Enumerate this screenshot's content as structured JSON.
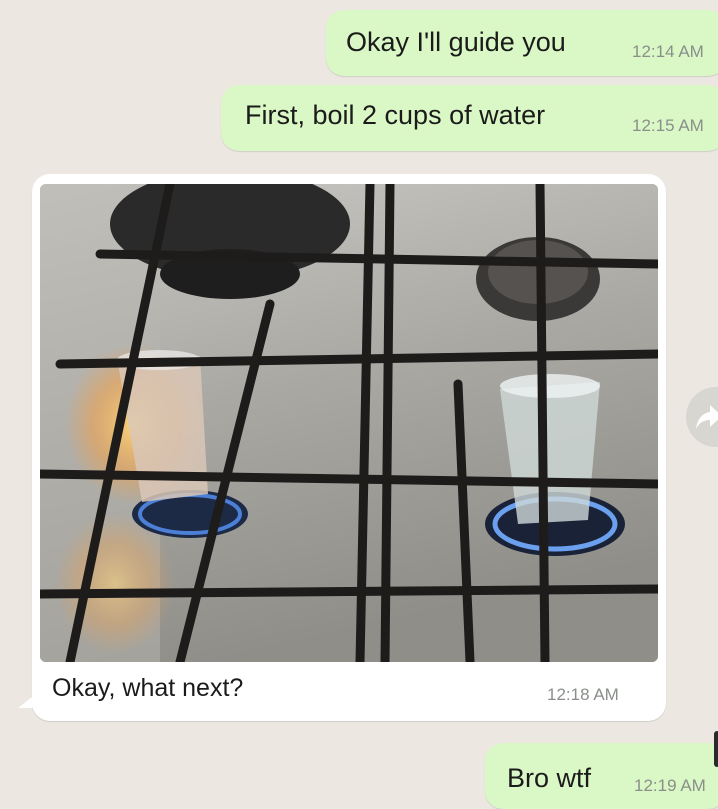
{
  "messages": [
    {
      "direction": "outgoing",
      "text": "Okay I'll guide you",
      "time": "12:14 AM"
    },
    {
      "direction": "outgoing",
      "text": "First, boil 2 cups of water",
      "time": "12:15 AM"
    },
    {
      "direction": "incoming",
      "text": "Okay, what next?",
      "time": "12:18 AM",
      "has_image": true
    },
    {
      "direction": "outgoing",
      "text": "Bro wtf",
      "time": "12:19 AM"
    }
  ],
  "icons": {
    "share": "forward-icon"
  },
  "colors": {
    "background": "#ece8e1",
    "outgoing_bubble": "#daf7c6",
    "incoming_bubble": "#ffffff",
    "timestamp": "#8a8f8a"
  }
}
